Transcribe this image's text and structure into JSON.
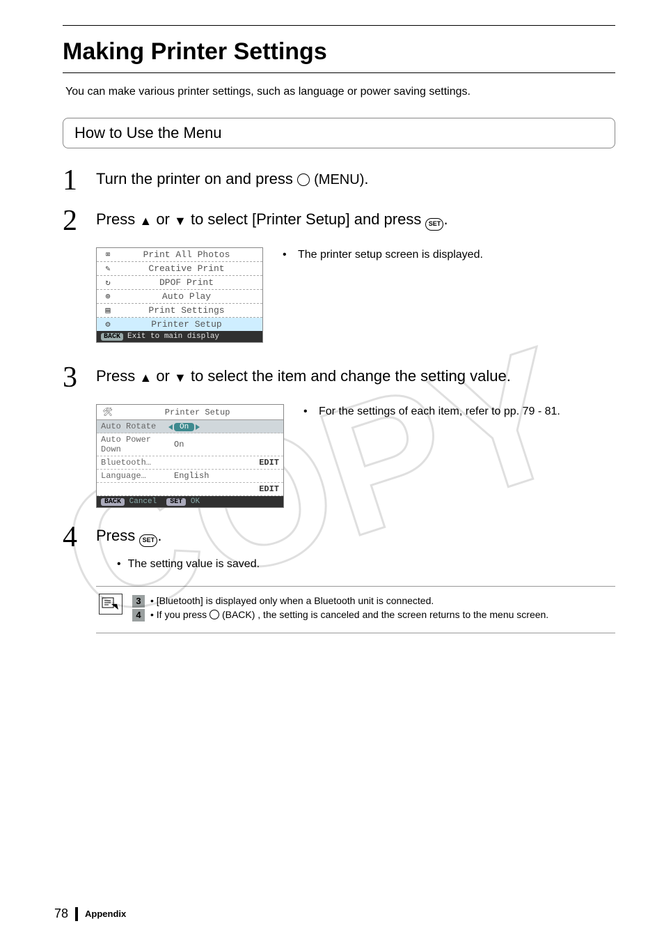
{
  "title": "Making Printer Settings",
  "intro": "You can make various printer settings, such as language or power saving settings.",
  "section_head": "How to Use the Menu",
  "steps": {
    "s1": {
      "num": "1",
      "pre": "Turn the printer on and press ",
      "btn": "(MENU)",
      "post": "."
    },
    "s2": {
      "num": "2",
      "pre": "Press ",
      "mid": " or ",
      "post1": " to select [Printer Setup] and press ",
      "post2": "."
    },
    "s2_caption": "The printer setup screen is displayed.",
    "s3": {
      "num": "3",
      "pre": "Press ",
      "mid": " or ",
      "post": " to select the item and change the setting value."
    },
    "s3_caption": "For the settings of each item, refer to pp. 79 - 81.",
    "s4": {
      "num": "4",
      "pre": "Press ",
      "post": "."
    },
    "s4_bullet": "The setting value is saved."
  },
  "menu": {
    "items": [
      {
        "icon": "⌧",
        "label": "Print All Photos"
      },
      {
        "icon": "✎",
        "label": "Creative Print"
      },
      {
        "icon": "↻",
        "label": "DPOF Print"
      },
      {
        "icon": "⊕",
        "label": "Auto Play"
      },
      {
        "icon": "▤",
        "label": "Print Settings"
      },
      {
        "icon": "⚙",
        "label": "Printer Setup"
      }
    ],
    "selected_index": 5,
    "footer_btn": "BACK",
    "footer_text": "Exit to main display"
  },
  "setup": {
    "title": "Printer Setup",
    "rows": [
      {
        "k": "Auto Rotate",
        "v": "On",
        "pill": true
      },
      {
        "k": "Auto Power Down",
        "v": "On"
      },
      {
        "k": "Bluetooth…",
        "v": "",
        "edit": "EDIT"
      },
      {
        "k": "Language…",
        "v": "English"
      },
      {
        "k": "",
        "v": "",
        "edit": "EDIT"
      }
    ],
    "footer": {
      "back": "BACK",
      "back_lbl": "Cancel",
      "set": "SET",
      "set_lbl": "OK"
    }
  },
  "notes": {
    "n3": "• [Bluetooth] is displayed only when a Bluetooth unit is connected.",
    "n4_pre": "• If you press ",
    "n4_btn": "(BACK)",
    "n4_post": ", the setting is canceled and the screen returns to the menu screen."
  },
  "footer": {
    "page": "78",
    "section": "Appendix"
  },
  "set_label": "SET"
}
